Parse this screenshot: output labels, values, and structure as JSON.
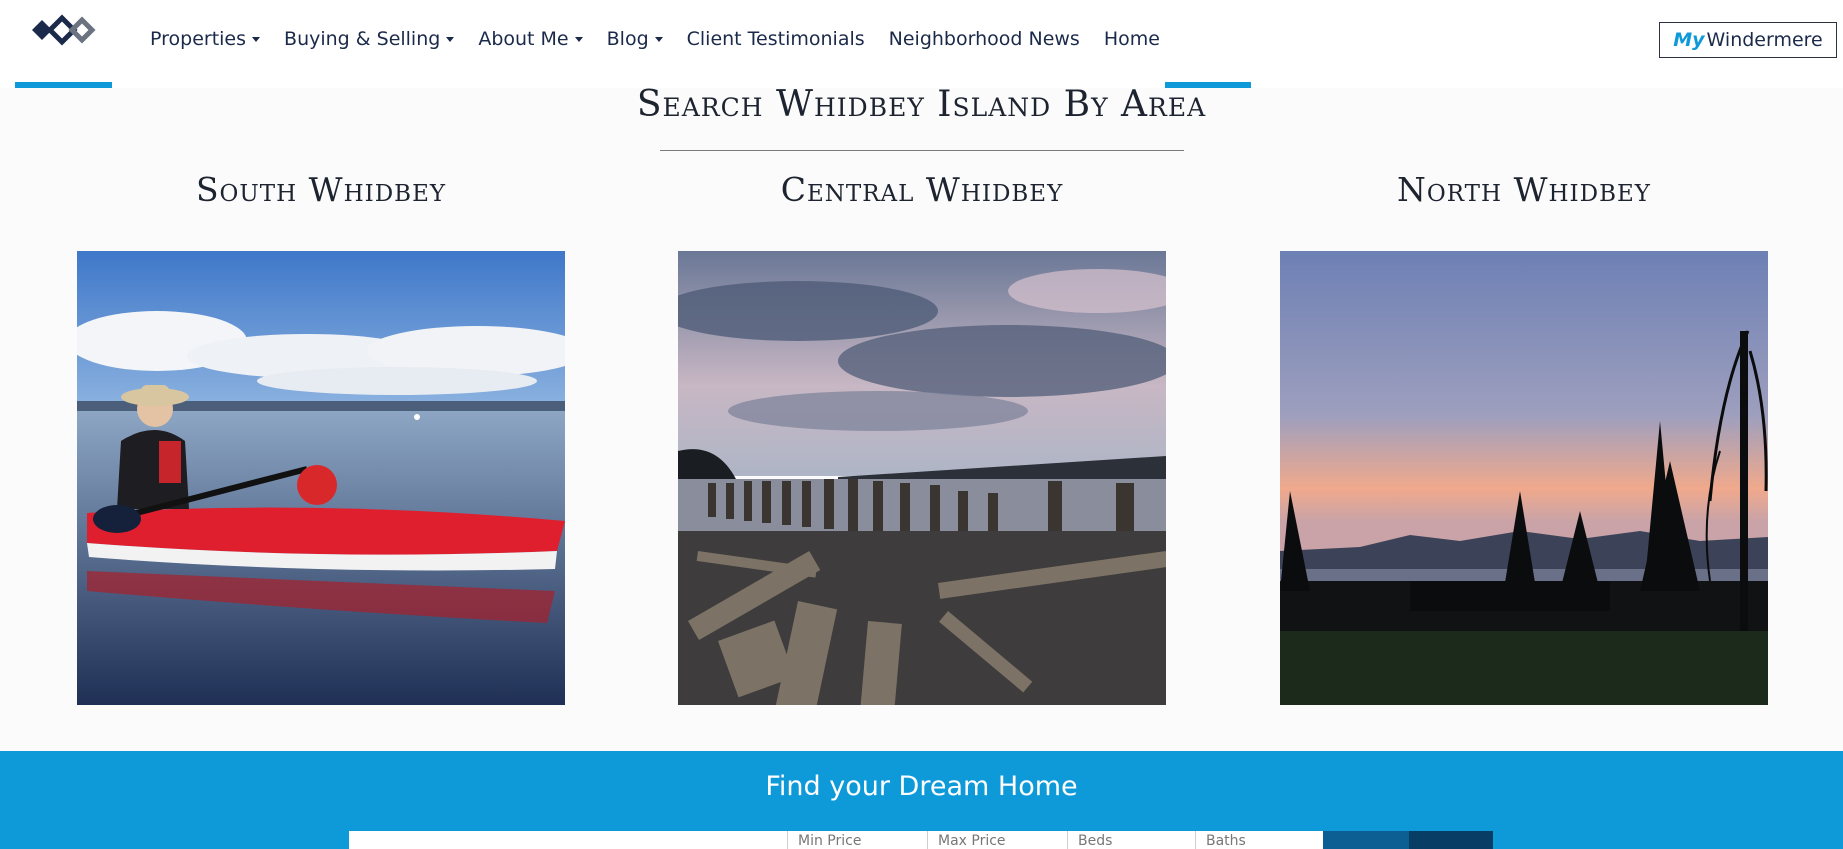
{
  "header": {
    "logo_name": "windermere-logo",
    "nav": [
      {
        "label": "Properties",
        "dropdown": true
      },
      {
        "label": "Buying & Selling",
        "dropdown": true
      },
      {
        "label": "About Me",
        "dropdown": true
      },
      {
        "label": "Blog",
        "dropdown": true
      },
      {
        "label": "Client Testimonials",
        "dropdown": false
      },
      {
        "label": "Neighborhood News",
        "dropdown": false
      },
      {
        "label": "Home",
        "dropdown": false
      }
    ],
    "mywindermere": {
      "my": "My",
      "rest": "Windermere"
    },
    "accent": "#0e9ad8"
  },
  "areas": {
    "title": "Search Whidbey Island By Area",
    "items": [
      {
        "title": "South Whidbey",
        "photo": "kayaker-on-calm-water"
      },
      {
        "title": "Central Whidbey",
        "photo": "driftwood-beach-pilings-cloudy-sky"
      },
      {
        "title": "North Whidbey",
        "photo": "sunset-over-trees-and-water"
      }
    ]
  },
  "dream": {
    "title": "Find your Dream Home",
    "fields": [
      "Min Price",
      "Max Price",
      "Beds",
      "Baths"
    ],
    "bg": "#0e9ad8"
  }
}
